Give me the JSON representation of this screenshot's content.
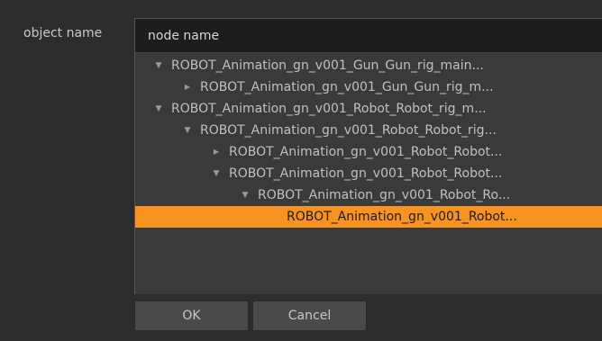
{
  "dialog": {
    "label": "object name",
    "ok_label": "OK",
    "cancel_label": "Cancel"
  },
  "tree": {
    "header": "node name",
    "rows": [
      {
        "label": "ROBOT_Animation_gn_v001_Gun_Gun_rig_main...",
        "depth": 0,
        "expander": "expanded",
        "selected": false
      },
      {
        "label": "ROBOT_Animation_gn_v001_Gun_Gun_rig_m...",
        "depth": 1,
        "expander": "collapsed",
        "selected": false
      },
      {
        "label": "ROBOT_Animation_gn_v001_Robot_Robot_rig_m...",
        "depth": 0,
        "expander": "expanded",
        "selected": false
      },
      {
        "label": "ROBOT_Animation_gn_v001_Robot_Robot_rig...",
        "depth": 1,
        "expander": "expanded",
        "selected": false
      },
      {
        "label": "ROBOT_Animation_gn_v001_Robot_Robot...",
        "depth": 2,
        "expander": "collapsed",
        "selected": false
      },
      {
        "label": "ROBOT_Animation_gn_v001_Robot_Robot...",
        "depth": 2,
        "expander": "expanded",
        "selected": false
      },
      {
        "label": "ROBOT_Animation_gn_v001_Robot_Ro...",
        "depth": 3,
        "expander": "expanded",
        "selected": false
      },
      {
        "label": "ROBOT_Animation_gn_v001_Robot...",
        "depth": 4,
        "expander": "none",
        "selected": true
      }
    ]
  },
  "colors": {
    "selection": "#f7931e",
    "background": "#2d2d2d",
    "tree_background": "#3a3a3a",
    "header_background": "#1d1d1d"
  }
}
